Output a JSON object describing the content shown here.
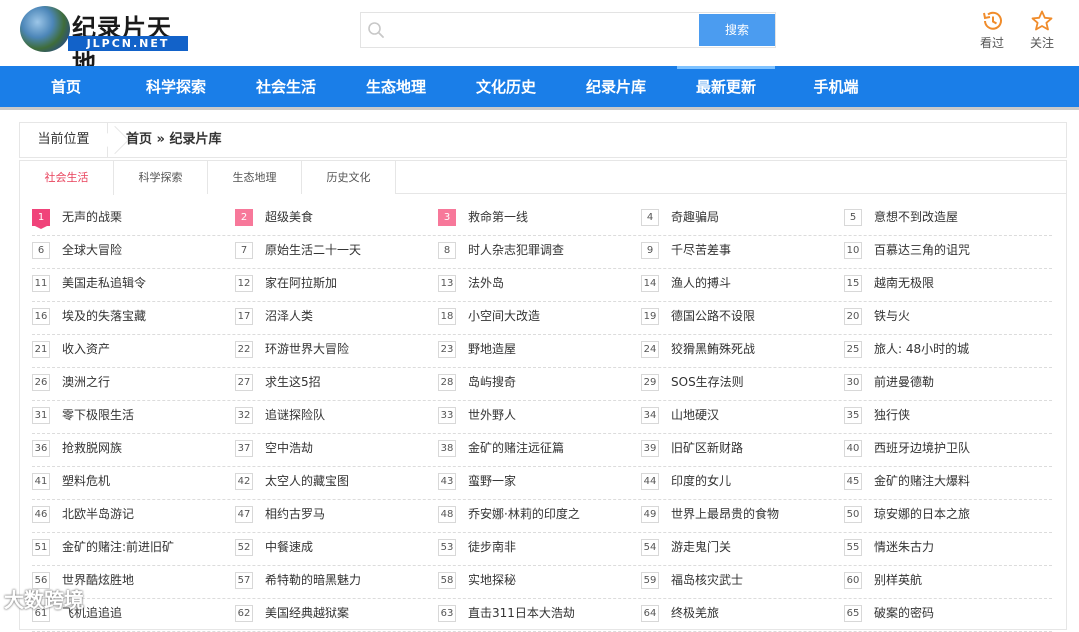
{
  "header": {
    "logo_title": "纪录片天地",
    "logo_sub": "JLPCN.NET",
    "search": {
      "placeholder": "",
      "button": "搜索"
    },
    "history_label": "看过",
    "follow_label": "关注"
  },
  "nav": [
    "首页",
    "科学探索",
    "社会生活",
    "生态地理",
    "文化历史",
    "纪录片库",
    "最新更新",
    "手机端"
  ],
  "breadcrumb": {
    "label": "当前位置",
    "path": "首页 » 纪录片库"
  },
  "tabs": [
    "社会生活",
    "科学探索",
    "生态地理",
    "历史文化"
  ],
  "list": [
    "无声的战栗",
    "超级美食",
    "救命第一线",
    "奇趣骗局",
    "意想不到改造屋",
    "全球大冒险",
    "原始生活二十一天",
    "时人杂志犯罪调查",
    "千尽苦差事",
    "百慕达三角的诅咒",
    "美国走私追辑令",
    "家在阿拉斯加",
    "法外岛",
    "渔人的搏斗",
    "越南无极限",
    "埃及的失落宝藏",
    "沼泽人类",
    "小空间大改造",
    "德国公路不设限",
    "铁与火",
    "收入资产",
    "环游世界大冒险",
    "野地造屋",
    "狡猾黑鲔殊死战",
    "旅人: 48小时的城",
    "澳洲之行",
    "求生这5招",
    "岛屿搜奇",
    "SOS生存法则",
    "前进曼德勒",
    "零下极限生活",
    "追谜探险队",
    "世外野人",
    "山地硬汉",
    "独行侠",
    "抢救脱网族",
    "空中浩劫",
    "金矿的赌注远征篇",
    "旧矿区新财路",
    "西班牙边境护卫队",
    "塑料危机",
    "太空人的藏宝图",
    "蛮野一家",
    "印度的女儿",
    "金矿的赌注大爆料",
    "北欧半岛游记",
    "相约古罗马",
    "乔安娜·林莉的印度之",
    "世界上最昂贵的食物",
    "琼安娜的日本之旅",
    "金矿的赌注:前进旧矿",
    "中餐速成",
    "徒步南非",
    "游走鬼门关",
    "情迷朱古力",
    "世界酷炫胜地",
    "希特勒的暗黑魅力",
    "实地探秘",
    "福岛核灾武士",
    "别样英航",
    "飞机追追追",
    "美国经典越狱案",
    "直击311日本大浩劫",
    "终极羌旅",
    "破案的密码"
  ],
  "watermark": "大数跨境",
  "colors": {
    "nav_bg": "#1a7ee8",
    "search_button": "#4b9cf0",
    "active_tab": "#e8425c",
    "hot_badge": "#f0437a",
    "icon_accent": "#f08c2b"
  }
}
